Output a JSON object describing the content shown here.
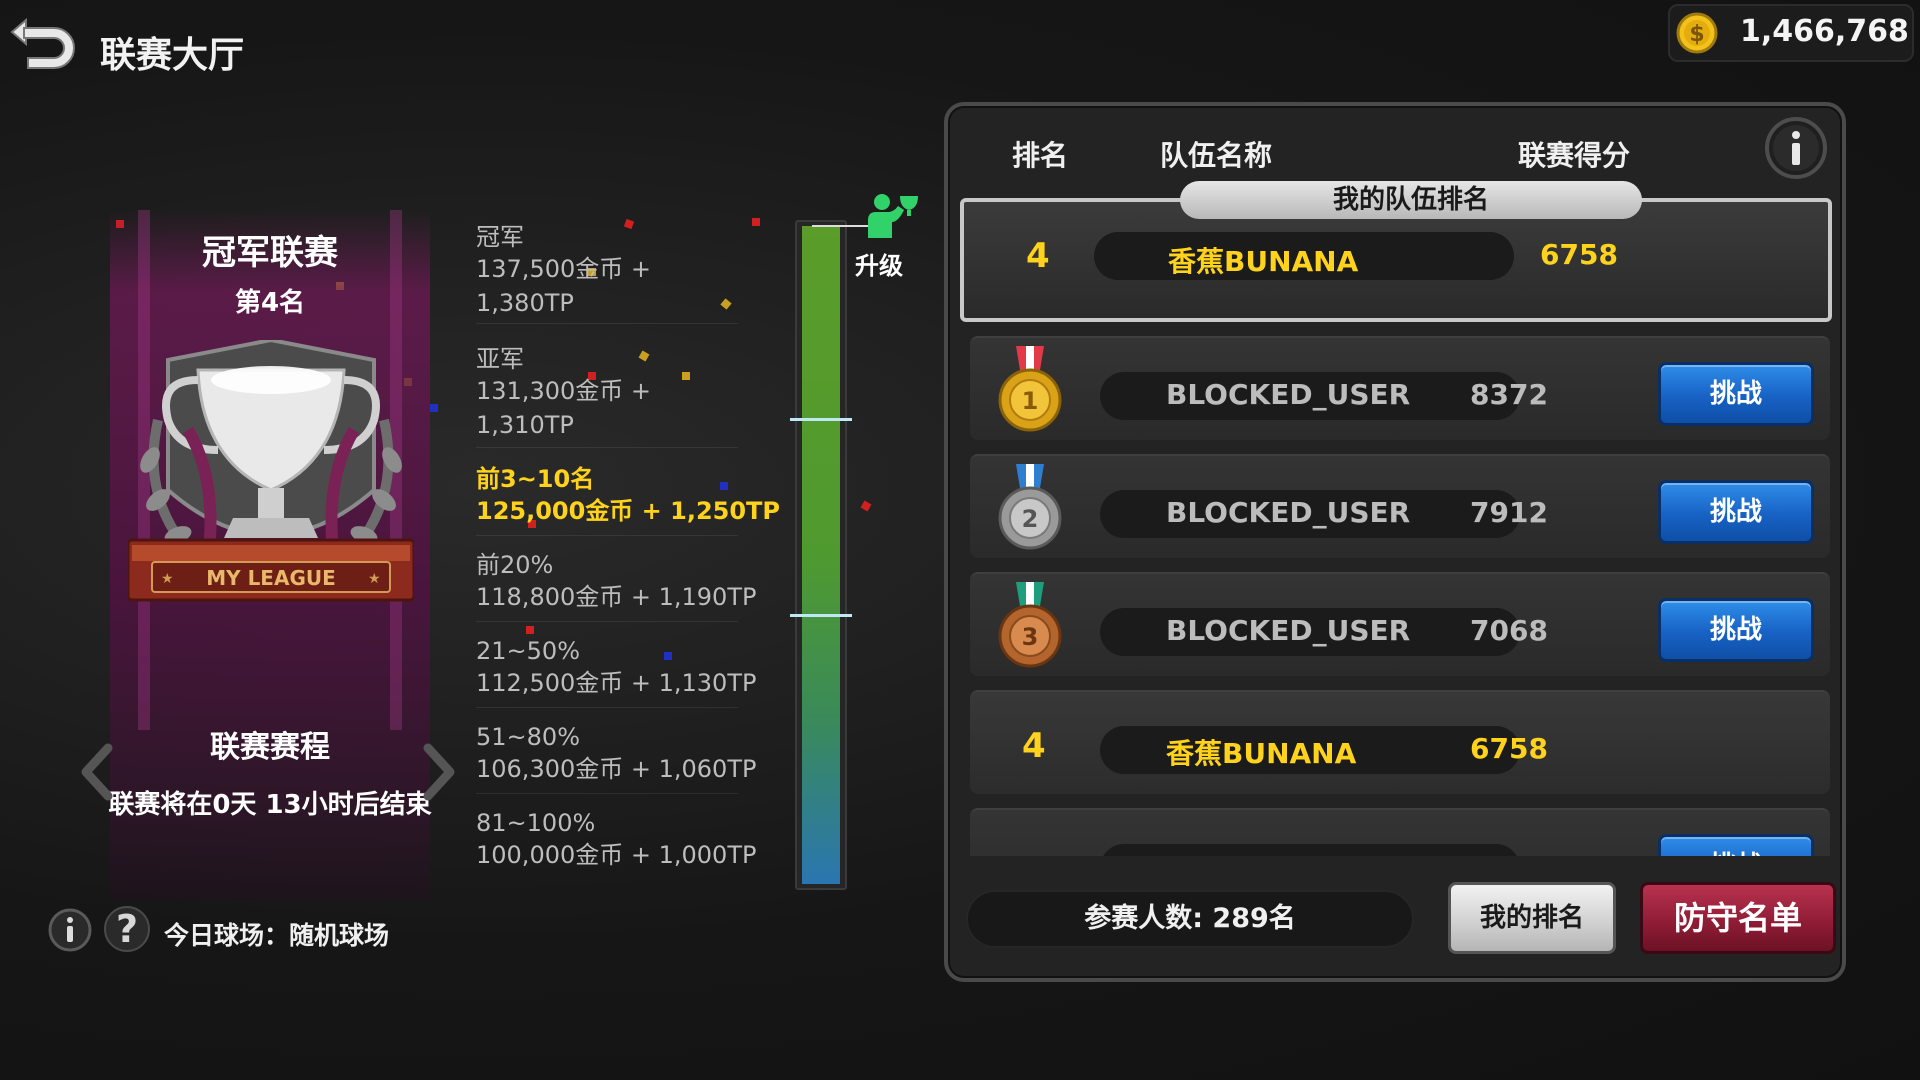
{
  "header": {
    "title": "联赛大厅",
    "coins": "1,466,768",
    "back_icon": "back-arrow-icon",
    "coin_icon": "dollar-coin-icon"
  },
  "league": {
    "name": "冠军联赛",
    "rank": "第4名",
    "trophy_plate": "MY LEAGUE",
    "schedule_title": "联赛赛程",
    "schedule_text": "联赛将在0天 13小时后结束"
  },
  "rewards": [
    {
      "title": "冠军",
      "line1": "137,500金币 +",
      "line2": "1,380TP",
      "current": false
    },
    {
      "title": "亚军",
      "line1": "131,300金币 +",
      "line2": "1,310TP",
      "current": false
    },
    {
      "title": "前3~10名",
      "line1": "125,000金币 + 1,250TP",
      "line2": "",
      "current": true
    },
    {
      "title": "前20%",
      "line1": "118,800金币 + 1,190TP",
      "line2": "",
      "current": false
    },
    {
      "title": "21~50%",
      "line1": "112,500金币 + 1,130TP",
      "line2": "",
      "current": false
    },
    {
      "title": "51~80%",
      "line1": "106,300金币 + 1,060TP",
      "line2": "",
      "current": false
    },
    {
      "title": "81~100%",
      "line1": "100,000金币 + 1,000TP",
      "line2": "",
      "current": false
    }
  ],
  "progress": {
    "promote_label": "升级"
  },
  "footer_left": {
    "today_field": "今日球场：随机球场"
  },
  "ranking": {
    "col_rank": "排名",
    "col_team": "队伍名称",
    "col_score": "联赛得分",
    "my_label": "我的队伍排名",
    "my_team": {
      "rank": "4",
      "name": "香蕉BUNANA",
      "score": "6758"
    },
    "rows": [
      {
        "rank": "1",
        "name": "BLOCKED_USER",
        "score": "8372",
        "button": "挑战",
        "medal": "gold"
      },
      {
        "rank": "2",
        "name": "BLOCKED_USER",
        "score": "7912",
        "button": "挑战",
        "medal": "silver"
      },
      {
        "rank": "3",
        "name": "BLOCKED_USER",
        "score": "7068",
        "button": "挑战",
        "medal": "bronze"
      },
      {
        "rank": "4",
        "name": "香蕉BUNANA",
        "score": "6758",
        "button": "",
        "medal": ""
      },
      {
        "rank": "",
        "name": "",
        "score": "",
        "button": "挑战",
        "medal": ""
      }
    ],
    "participants": "参赛人数: 289名",
    "my_rank_button": "我的排名",
    "defense_button": "防守名单"
  },
  "colors": {
    "gold_text": "#ffd21c",
    "challenge_blue": "#1762c4",
    "defense_red": "#8d1b34",
    "league_purple": "#6e1955"
  }
}
